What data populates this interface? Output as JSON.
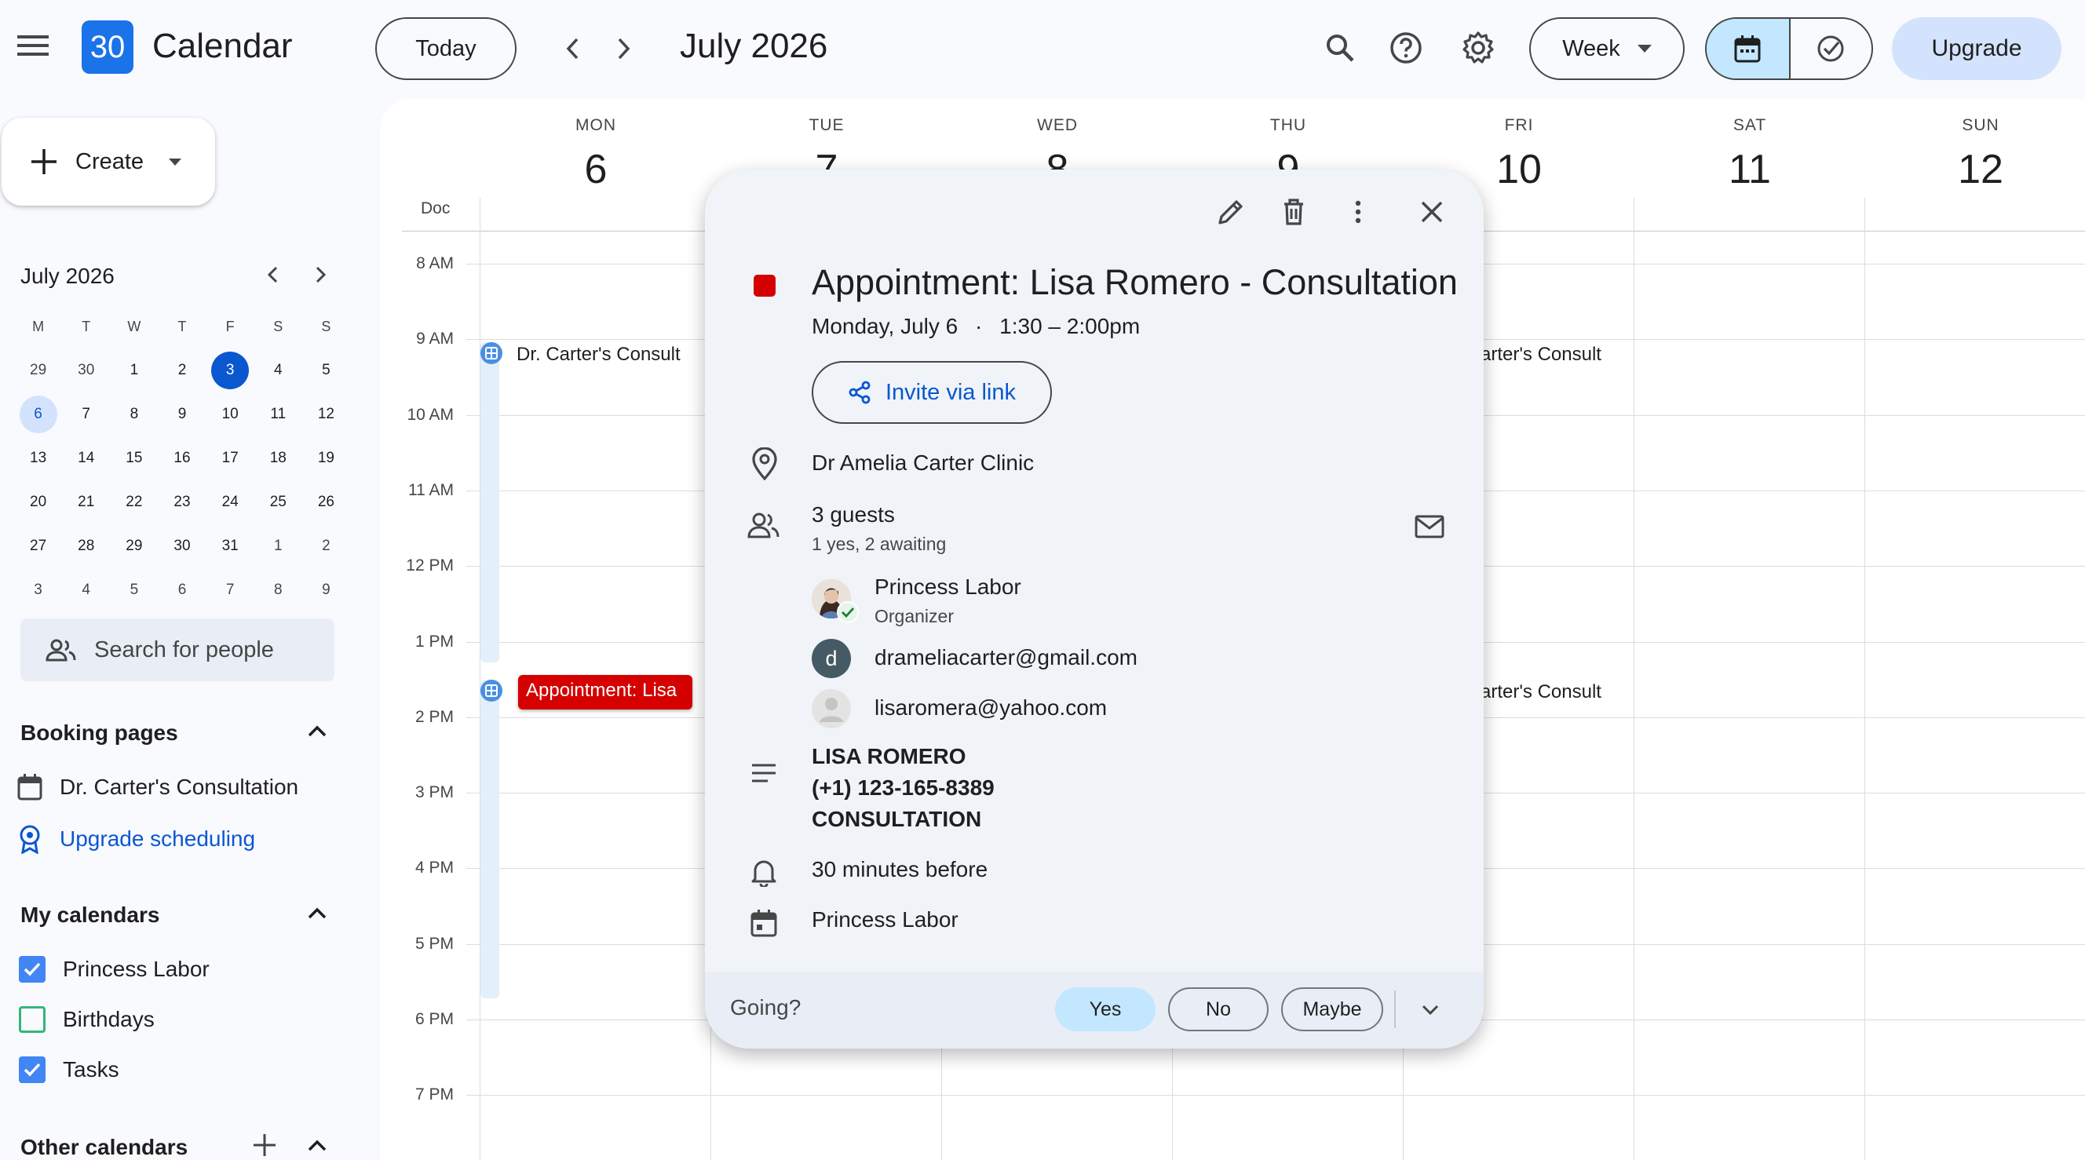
{
  "app": {
    "title": "Calendar",
    "logo_day": "30"
  },
  "toolbar": {
    "today_label": "Today",
    "current_period": "July 2026",
    "view_label": "Week",
    "upgrade_label": "Upgrade"
  },
  "sidebar": {
    "create_label": "Create",
    "mini_calendar": {
      "title": "July 2026",
      "weekdays": [
        "M",
        "T",
        "W",
        "T",
        "F",
        "S",
        "S"
      ],
      "weeks": [
        [
          "29",
          "30",
          "1",
          "2",
          "3",
          "4",
          "5"
        ],
        [
          "6",
          "7",
          "8",
          "9",
          "10",
          "11",
          "12"
        ],
        [
          "13",
          "14",
          "15",
          "16",
          "17",
          "18",
          "19"
        ],
        [
          "20",
          "21",
          "22",
          "23",
          "24",
          "25",
          "26"
        ],
        [
          "27",
          "28",
          "29",
          "30",
          "31",
          "1",
          "2"
        ],
        [
          "3",
          "4",
          "5",
          "6",
          "7",
          "8",
          "9"
        ]
      ]
    },
    "search_placeholder": "Search for people",
    "booking": {
      "title": "Booking pages",
      "items": [
        "Dr. Carter's Consultation",
        "Upgrade scheduling"
      ]
    },
    "my_calendars": {
      "title": "My calendars",
      "items": [
        "Princess Labor",
        "Birthdays",
        "Tasks"
      ]
    },
    "other_calendars": {
      "title": "Other calendars"
    }
  },
  "week": {
    "days": [
      {
        "dow": "MON",
        "num": "6"
      },
      {
        "dow": "TUE",
        "num": "7"
      },
      {
        "dow": "WED",
        "num": "8"
      },
      {
        "dow": "THU",
        "num": "9"
      },
      {
        "dow": "FRI",
        "num": "10"
      },
      {
        "dow": "SAT",
        "num": "11"
      },
      {
        "dow": "SUN",
        "num": "12"
      }
    ],
    "allday_label": "Doc",
    "hours": [
      "8 AM",
      "9 AM",
      "10 AM",
      "11 AM",
      "12 PM",
      "1 PM",
      "2 PM",
      "3 PM",
      "4 PM",
      "5 PM",
      "6 PM",
      "7 PM"
    ],
    "events": {
      "mon_consult": "Dr. Carter's Consult",
      "mon_appt": "Appointment: Lisa",
      "fri_consult_1": "arter's Consult",
      "fri_consult_2": "arter's Consult"
    }
  },
  "popup": {
    "title": "Appointment: Lisa Romero - Consultation",
    "date": "Monday, July 6",
    "dot": "·",
    "time": "1:30 – 2:00pm",
    "invite_label": "Invite via link",
    "location": "Dr Amelia Carter Clinic",
    "guests_count": "3 guests",
    "guests_status": "1 yes, 2 awaiting",
    "guests": [
      {
        "name": "Princess Labor",
        "role": "Organizer"
      },
      {
        "name": "drameliacarter@gmail.com",
        "initial": "d"
      },
      {
        "name": "lisaromera@yahoo.com"
      }
    ],
    "description": [
      "LISA ROMERO",
      "(+1) 123-165-8389",
      "CONSULTATION"
    ],
    "reminder": "30 minutes before",
    "calendar": "Princess Labor",
    "going_label": "Going?",
    "rsvp": [
      "Yes",
      "No",
      "Maybe"
    ],
    "event_color": "#d50000"
  }
}
